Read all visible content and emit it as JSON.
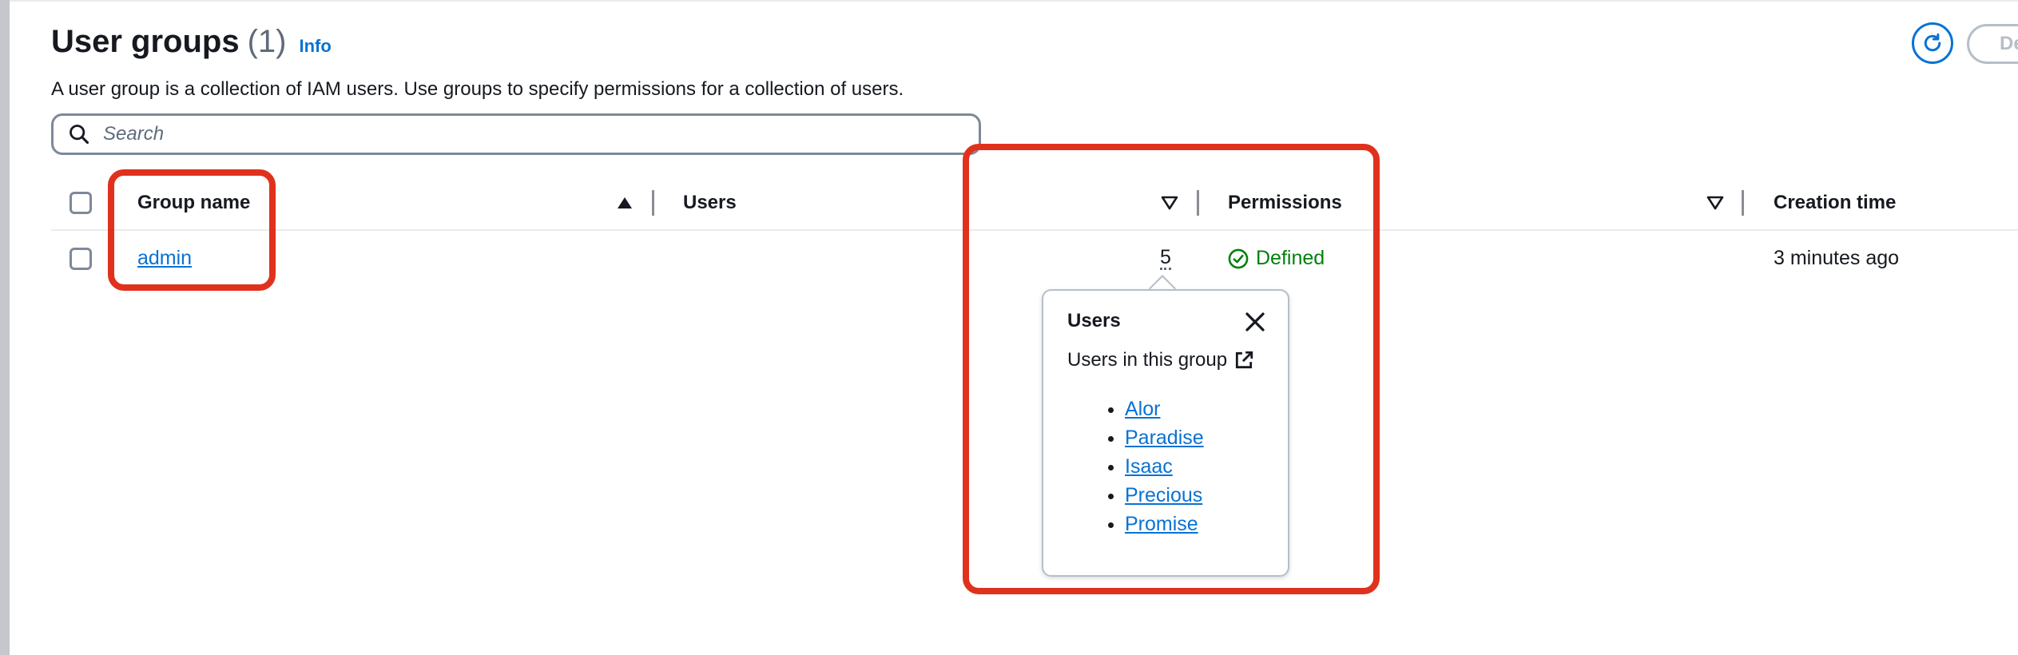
{
  "header": {
    "title": "User groups",
    "count": "(1)",
    "info_link": "Info",
    "description": "A user group is a collection of IAM users. Use groups to specify permissions for a collection of users.",
    "cut_button_label": "De"
  },
  "search": {
    "placeholder": "Search",
    "value": ""
  },
  "table": {
    "columns": [
      "Group name",
      "Users",
      "Permissions",
      "Creation time"
    ],
    "rows": [
      {
        "group_name": "admin",
        "users": "5",
        "permissions": "Defined",
        "creation_time": "3 minutes ago"
      }
    ]
  },
  "popover": {
    "title": "Users",
    "subtitle": "Users in this group",
    "users": [
      "Alor",
      "Paradise",
      "Isaac",
      "Precious",
      "Promise"
    ]
  },
  "colors": {
    "link": "#0972d3",
    "success": "#037f0c",
    "annotation": "#e0311d",
    "text": "#16191f"
  },
  "icons": {
    "search": "search-icon",
    "refresh": "refresh-icon",
    "sort_ascending": "caret-up-filled-icon",
    "sort_descending": "caret-down-outline-icon",
    "success": "status-positive-icon",
    "close": "close-icon",
    "external": "external-link-icon"
  }
}
